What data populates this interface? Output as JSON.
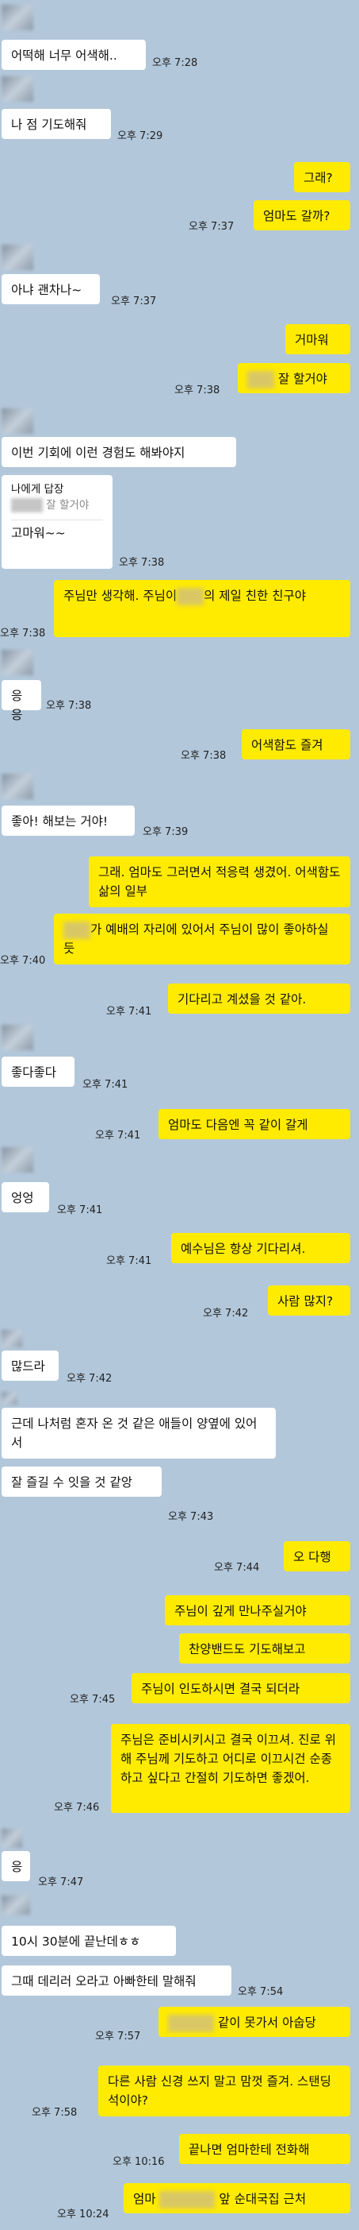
{
  "messages": [
    {
      "text": "어떡해 너무 어색해..",
      "time": "오후 7:28"
    },
    {
      "text": "나 점 기도해줘",
      "time": "오후 7:29"
    },
    {
      "text": "그래?"
    },
    {
      "text": "엄마도 갈까?",
      "time": "오후 7:37"
    },
    {
      "text": "아냐 괜차나~",
      "time": "오후 7:37"
    },
    {
      "text": "거마워"
    },
    {
      "text": "잘 할거야",
      "time": "오후 7:38"
    },
    {
      "text": "이번 기회에 이런 경험도 해봐야지"
    },
    {
      "text": "나에게 답장",
      "sub": "잘 할거야",
      "body": "고마워~~",
      "time": "오후 7:38"
    },
    {
      "text": "주님만 생각해. 주님이",
      "text2": "의 제일 친한 친구야",
      "time": "오후 7:38"
    },
    {
      "text": "응응",
      "time": "오후 7:38"
    },
    {
      "text": "어색함도 즐겨",
      "time": "오후 7:38"
    },
    {
      "text": "좋아! 해보는 거야!",
      "time": "오후 7:39"
    },
    {
      "text": "그래. 엄마도 그러면서 적응력 생겼어. 어색함도 삶의 일부"
    },
    {
      "text": "가 예배의 자리에 있어서 주님이 많이 좋아하실 듯",
      "time": "오후 7:40"
    },
    {
      "text": "기다리고 계셨을 것 같아.",
      "time": "오후 7:41"
    },
    {
      "text": "좋다좋다",
      "time": "오후 7:41"
    },
    {
      "text": "엄마도 다음엔 꼭 같이 갈게",
      "time": "오후 7:41"
    },
    {
      "text": "엉엉",
      "time": "오후 7:41"
    },
    {
      "text": "예수님은 항상 기다리셔.",
      "time": "오후 7:41"
    },
    {
      "text": "사람 많지?",
      "time": "오후 7:42"
    },
    {
      "text": "많드라",
      "time": "오후 7:42"
    },
    {
      "text": "근데 나처럼 혼자 온 것 같은 애들이 양옆에 있어서"
    },
    {
      "text": "잘 즐길 수 잇을 것 같앙",
      "time": "오후 7:43"
    },
    {
      "text": "오 다행",
      "time": "오후 7:44"
    },
    {
      "text": "주님이 깊게 만나주실거야"
    },
    {
      "text": "찬양밴드도 기도해보고"
    },
    {
      "text": "주님이 인도하시면 결국 되더라",
      "time": "오후 7:45"
    },
    {
      "text": "주님은 준비시키시고 결국 이끄셔. 진로 위해 주님께 기도하고 어디로 이끄시건 순종하고 싶다고 간절히 기도하면 좋겠어.",
      "time": "오후 7:46"
    },
    {
      "text": "응",
      "time": "오후 7:47"
    },
    {
      "text": "10시 30분에 끝난데ㅎㅎ"
    },
    {
      "text": "그때 데리러 오라고 아빠한테 말해줘",
      "time": "오후 7:54"
    },
    {
      "text": "같이 못가서 아숩당",
      "time": "오후 7:57"
    },
    {
      "text": "다른 사람 신경 쓰지 말고 맘껏 즐겨. 스탠딩석이야?",
      "time": "오후 7:58"
    },
    {
      "text": "끝나면 엄마한테 전화해",
      "time": "오후 10:16"
    },
    {
      "text": "엄마",
      "text2": "앞 순대국집 근처",
      "time": "오후 10:24"
    }
  ]
}
